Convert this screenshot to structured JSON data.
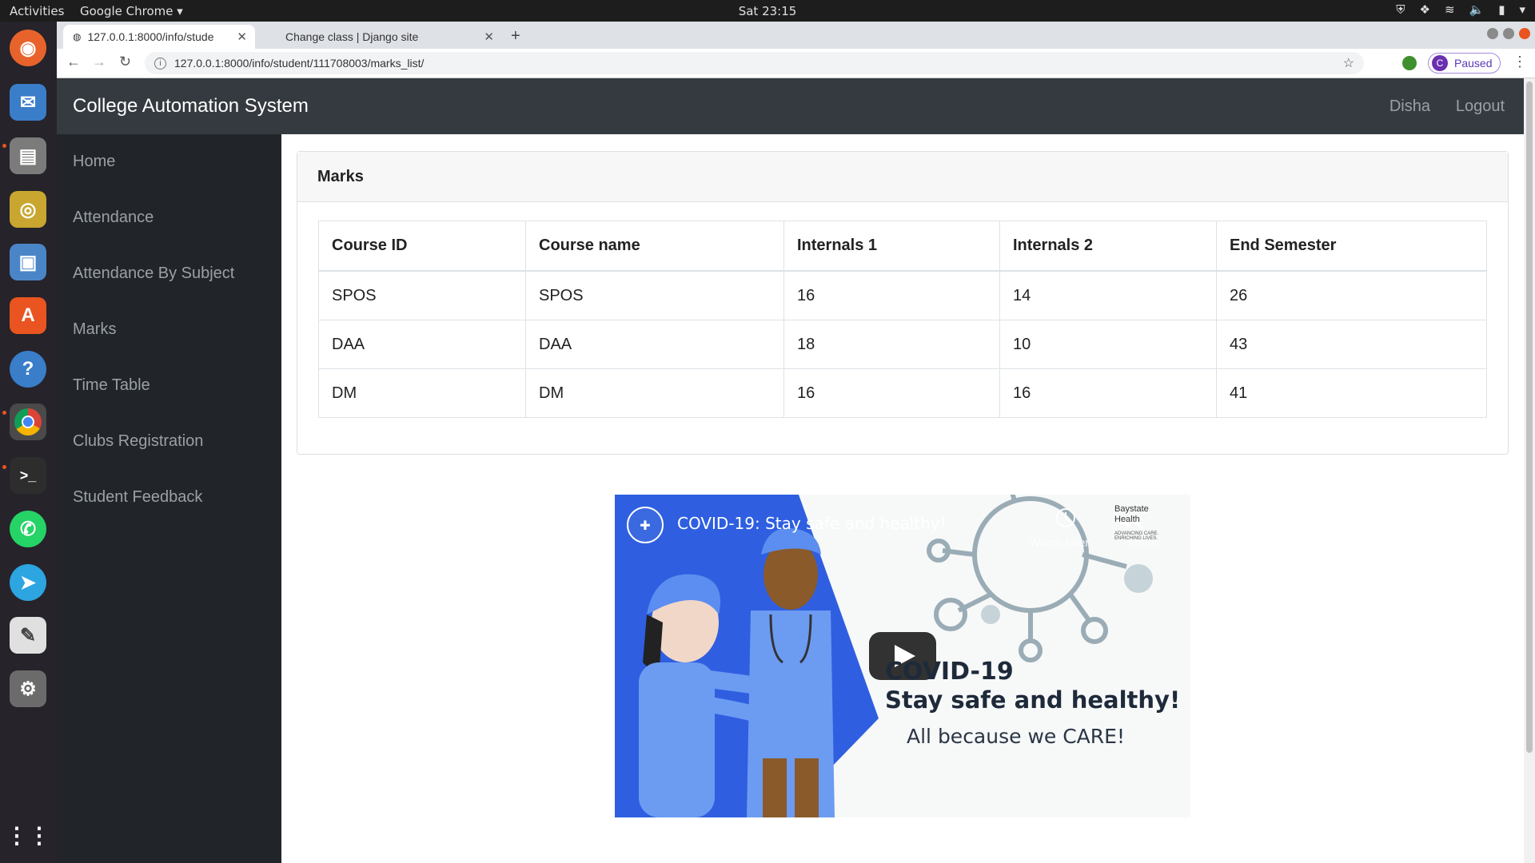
{
  "desktop": {
    "activities": "Activities",
    "app_menu": "Google Chrome ▾",
    "clock": "Sat 23:15"
  },
  "browser": {
    "tabs": [
      {
        "title": "127.0.0.1:8000/info/stude",
        "active": true
      },
      {
        "title": "Change class | Django site",
        "active": false
      }
    ],
    "url": "127.0.0.1:8000/info/student/111708003/marks_list/",
    "profile_initial": "C",
    "profile_status": "Paused"
  },
  "app": {
    "brand": "College Automation System",
    "user": "Disha",
    "logout": "Logout"
  },
  "sidebar": {
    "items": [
      {
        "label": "Home"
      },
      {
        "label": "Attendance"
      },
      {
        "label": "Attendance By Subject"
      },
      {
        "label": "Marks"
      },
      {
        "label": "Time Table"
      },
      {
        "label": "Clubs Registration"
      },
      {
        "label": "Student Feedback"
      }
    ]
  },
  "marks": {
    "title": "Marks",
    "columns": [
      "Course ID",
      "Course name",
      "Internals 1",
      "Internals 2",
      "End Semester"
    ],
    "rows": [
      [
        "SPOS",
        "SPOS",
        "16",
        "14",
        "26"
      ],
      [
        "DAA",
        "DAA",
        "18",
        "10",
        "43"
      ],
      [
        "DM",
        "DM",
        "16",
        "16",
        "41"
      ]
    ]
  },
  "video": {
    "title": "COVID-19: Stay safe and healthy!",
    "watch_later": "Watch later",
    "share": "Share",
    "org": "Baystate Health",
    "tagline": "ADVANCING CARE. ENRICHING LIVES.",
    "heading1": "COVID-19",
    "heading2": "Stay safe and healthy!",
    "heading3": "All because we CARE!"
  },
  "colors": {
    "navbar": "#343a40",
    "sidebar": "#212529",
    "video_blue": "#2f5fe0"
  }
}
